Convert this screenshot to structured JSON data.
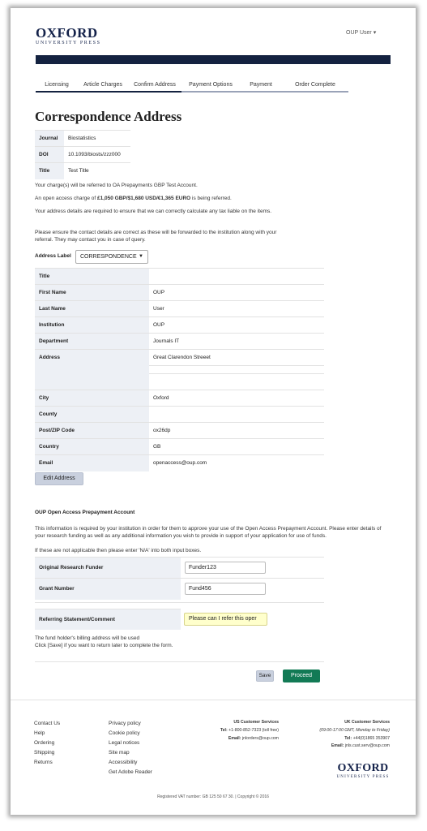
{
  "header": {
    "logo_main": "OXFORD",
    "logo_sub": "UNIVERSITY PRESS",
    "user_menu": "OUP User ▾"
  },
  "steps": [
    "Licensing",
    "Article Charges",
    "Confirm Address",
    "Payment Options",
    "Payment",
    "Order Complete"
  ],
  "page_title": "Correspondence Address",
  "info": {
    "journal_label": "Journal",
    "journal": "Biostatistics",
    "doi_label": "DOI",
    "doi": "10.1093/biosts/zzz000",
    "title_label": "Title",
    "title": "Test Title"
  },
  "notes": {
    "referral": "Your charge(s) will be referred to OA Prepayments GBP Test Account.",
    "charge_pre": "An open access charge of ",
    "charge_amount": "£1,050 GBP/$1,680 USD/€1,365 EURO",
    "charge_post": " is being referred.",
    "tax": "Your address details are required to ensure that we can correctly calculate any tax liable on the items.",
    "forward": "Please ensure the contact details are correct as these will be forwarded to the institution along with your referral. They may contact you in case of query."
  },
  "address_label": {
    "label": "Address Label",
    "value": "CORRESPONDENCE"
  },
  "address": {
    "title_label": "Title",
    "title": "",
    "first_name_label": "First Name",
    "first_name": "OUP",
    "last_name_label": "Last Name",
    "last_name": "User",
    "institution_label": "Institution",
    "institution": "OUP",
    "department_label": "Department",
    "department": "Journals IT",
    "address_label": "Address",
    "address": "Great Clarendon Streeet",
    "city_label": "City",
    "city": "Oxford",
    "county_label": "County",
    "county": "",
    "postcode_label": "Post/ZIP Code",
    "postcode": "ox26dp",
    "country_label": "Country",
    "country": "GB",
    "email_label": "Email",
    "email": "openaccess@oup.com"
  },
  "edit_button": "Edit Address",
  "prepayment": {
    "heading": "OUP Open Access Prepayment Account",
    "desc1": "This information is required by your institution in order for them to approve your use of the Open Access Prepayment Account. Please enter details of your research funding as well as any additional information you wish to provide in support of your application for use of funds.",
    "desc2": "If these are not applicable then please enter 'N/A' into both input boxes.",
    "funder_label": "Original Research Funder",
    "funder_value": "Funder123",
    "grant_label": "Grant Number",
    "grant_value": "Fund456",
    "statement_label": "Referring Statement/Comment",
    "statement_value": "Please can I refer this oper",
    "billing_note": "The fund holder's billing address will be used",
    "save_note": "Click [Save] if you want to return later to complete the form."
  },
  "buttons": {
    "save": "Save",
    "proceed": "Proceed"
  },
  "footer": {
    "col1": [
      "Contact Us",
      "Help",
      "Ordering",
      "Shipping",
      "Returns"
    ],
    "col2": [
      "Privacy policy",
      "Cookie policy",
      "Legal notices",
      "Site map",
      "Accessibility",
      "Get Adobe Reader"
    ],
    "us_title": "US Customer Services",
    "us_tel_label": "Tel:",
    "us_tel": "+1-800-852-7323 (toll free)",
    "us_email_label": "Email:",
    "us_email": "jnlorders@oup.com",
    "uk_title": "UK Customer Services",
    "uk_hours": "(09:00-17:00 GMT, Monday to Friday)",
    "uk_tel_label": "Tel:",
    "uk_tel": "+44(0)1865 353907",
    "uk_email_label": "Email:",
    "uk_email": "jnls.cust.serv@oup.com",
    "logo_main": "OXFORD",
    "logo_sub": "UNIVERSITY PRESS",
    "copyright": "Registered VAT number: GB 125 50 67 30.  |  Copyright © 2016"
  },
  "colors": {
    "navy": "#142240",
    "proceed": "#127a55",
    "label_bg": "#edf0f5",
    "highlight": "#ffffcc"
  }
}
